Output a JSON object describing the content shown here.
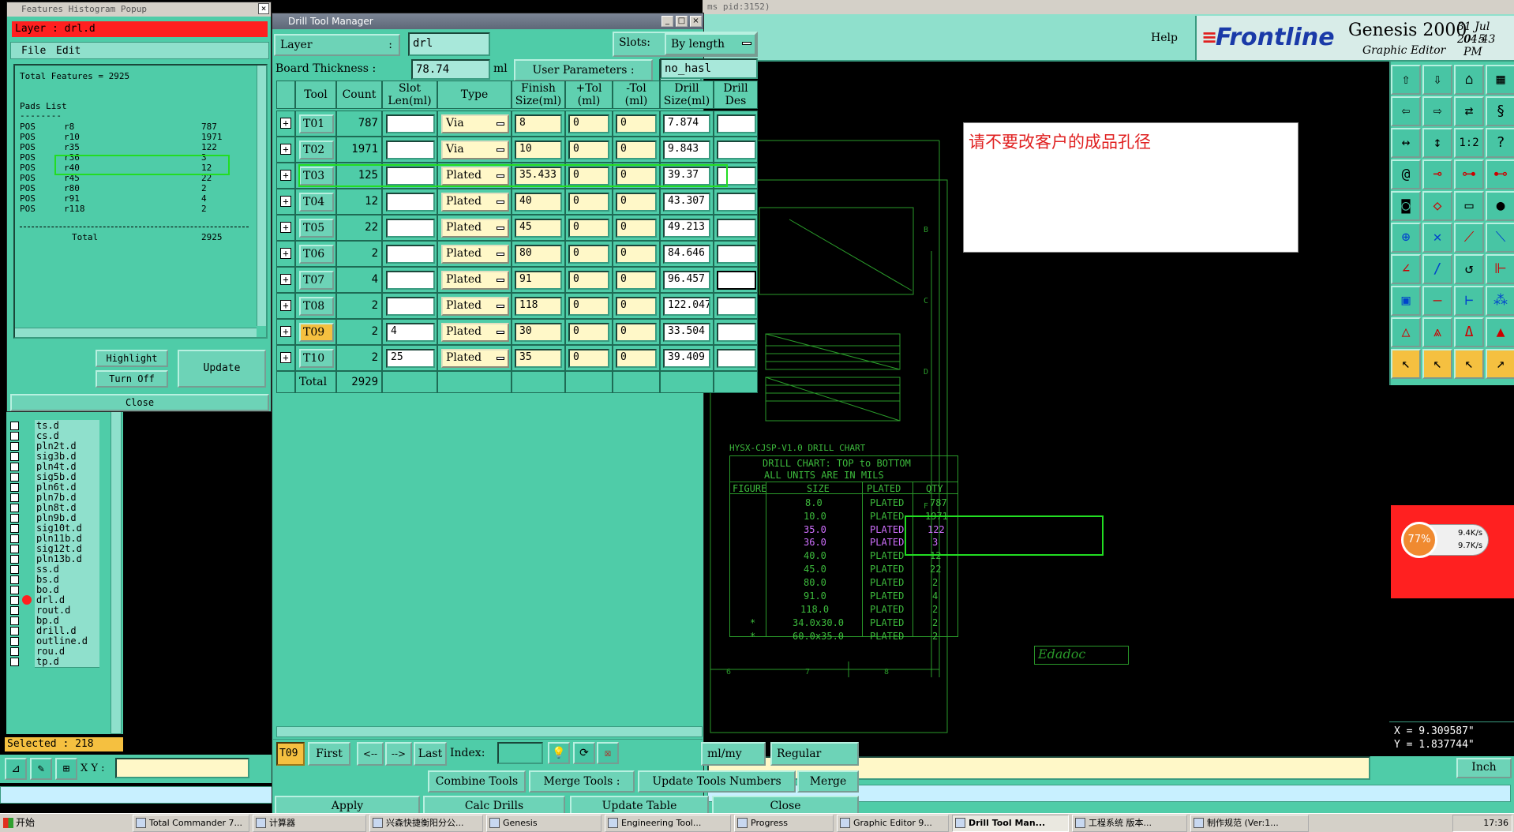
{
  "histogram": {
    "title": "Features Histogram Popup",
    "layer_label": "Layer : drl.d",
    "menu": [
      "File",
      "Edit"
    ],
    "total_features": "Total Features = 2925",
    "pads_list": "Pads List",
    "rows": [
      {
        "type": "POS",
        "sym": "r8",
        "count": "787"
      },
      {
        "type": "POS",
        "sym": "r10",
        "count": "1971"
      },
      {
        "type": "POS",
        "sym": "r35",
        "count": "122"
      },
      {
        "type": "POS",
        "sym": "r36",
        "count": "3"
      },
      {
        "type": "POS",
        "sym": "r40",
        "count": "12"
      },
      {
        "type": "POS",
        "sym": "r45",
        "count": "22"
      },
      {
        "type": "POS",
        "sym": "r80",
        "count": "2"
      },
      {
        "type": "POS",
        "sym": "r91",
        "count": "4"
      },
      {
        "type": "POS",
        "sym": "r118",
        "count": "2"
      }
    ],
    "total_label": "Total",
    "total_value": "2925",
    "highlight": "Highlight",
    "turn_off": "Turn Off",
    "update": "Update",
    "close": "Close"
  },
  "layers": {
    "items": [
      "ts.d",
      "cs.d",
      "pln2t.d",
      "sig3b.d",
      "pln4t.d",
      "sig5b.d",
      "pln6t.d",
      "pln7b.d",
      "pln8t.d",
      "pln9b.d",
      "sig10t.d",
      "pln11b.d",
      "sig12t.d",
      "pln13b.d",
      "ss.d",
      "bs.d",
      "bo.d",
      "drl.d",
      "rout.d",
      "bp.d",
      "drill.d",
      "outline.d",
      "rou.d",
      "tp.d"
    ],
    "selected": "Selected : 218",
    "xy_label": "X Y :"
  },
  "dtm": {
    "title": "Drill Tool Manager",
    "layer_label": "Layer",
    "layer_value": "drl",
    "slots_label": "Slots:",
    "slots_value": "By length",
    "board_thickness_label": "Board Thickness :",
    "board_thickness_value": "78.74",
    "board_thickness_unit": "ml",
    "user_params_label": "User Parameters :",
    "user_params_value": "no_hasl",
    "columns": [
      "Tool",
      "Count",
      "Slot Len(ml)",
      "Type",
      "Finish Size(ml)",
      "+Tol (ml)",
      "-Tol (ml)",
      "Drill Size(ml)",
      "Drill Des"
    ],
    "tools": [
      {
        "tool": "T01",
        "count": "787",
        "slot": "",
        "type": "Via",
        "finish": "8",
        "ptol": "0",
        "mtol": "0",
        "drill": "7.874"
      },
      {
        "tool": "T02",
        "count": "1971",
        "slot": "",
        "type": "Via",
        "finish": "10",
        "ptol": "0",
        "mtol": "0",
        "drill": "9.843"
      },
      {
        "tool": "T03",
        "count": "125",
        "slot": "",
        "type": "Plated",
        "finish": "35.433",
        "ptol": "0",
        "mtol": "0",
        "drill": "39.37"
      },
      {
        "tool": "T04",
        "count": "12",
        "slot": "",
        "type": "Plated",
        "finish": "40",
        "ptol": "0",
        "mtol": "0",
        "drill": "43.307"
      },
      {
        "tool": "T05",
        "count": "22",
        "slot": "",
        "type": "Plated",
        "finish": "45",
        "ptol": "0",
        "mtol": "0",
        "drill": "49.213"
      },
      {
        "tool": "T06",
        "count": "2",
        "slot": "",
        "type": "Plated",
        "finish": "80",
        "ptol": "0",
        "mtol": "0",
        "drill": "84.646"
      },
      {
        "tool": "T07",
        "count": "4",
        "slot": "",
        "type": "Plated",
        "finish": "91",
        "ptol": "0",
        "mtol": "0",
        "drill": "96.457"
      },
      {
        "tool": "T08",
        "count": "2",
        "slot": "",
        "type": "Plated",
        "finish": "118",
        "ptol": "0",
        "mtol": "0",
        "drill": "122.047"
      },
      {
        "tool": "T09",
        "count": "2",
        "slot": "4",
        "type": "Plated",
        "finish": "30",
        "ptol": "0",
        "mtol": "0",
        "drill": "33.504"
      },
      {
        "tool": "T10",
        "count": "2",
        "slot": "25",
        "type": "Plated",
        "finish": "35",
        "ptol": "0",
        "mtol": "0",
        "drill": "39.409"
      }
    ],
    "total_label": "Total",
    "total_value": "2929",
    "current_tool": "T09",
    "nav": [
      "First",
      "<--",
      "-->",
      "Last"
    ],
    "index_label": "Index:",
    "units": "ml/my",
    "mode": "Regular",
    "combine": "Combine Tools",
    "merge_tools": "Merge Tools :",
    "update_numbers": "Update Tools Numbers",
    "merge": "Merge",
    "apply": "Apply",
    "calc": "Calc Drills",
    "update_table": "Update Table",
    "close": "Close"
  },
  "genesis": {
    "help": "Help",
    "brand": "Frontline",
    "product": "Genesis 2000",
    "sub": "Graphic Editor",
    "date": "31 Jul 2015",
    "time": "04:43 PM",
    "note": "请不要改客户的成品孔径",
    "x": "X = 9.309587\"",
    "y": "Y = 1.837744\"",
    "unit": "Inch",
    "pid": "ms pid:3152)"
  },
  "drill_chart": {
    "heading": "HYSX-CJSP-V1.0 DRILL CHART",
    "title": "DRILL CHART: TOP to BOTTOM",
    "subtitle": "ALL UNITS ARE IN MILS",
    "cols": [
      "FIGURE",
      "SIZE",
      "PLATED",
      "QTY"
    ],
    "rows": [
      [
        "",
        "8.0",
        "PLATED",
        "787"
      ],
      [
        "",
        "10.0",
        "PLATED",
        "1971"
      ],
      [
        "",
        "35.0",
        "PLATED",
        "122"
      ],
      [
        "",
        "36.0",
        "PLATED",
        "3"
      ],
      [
        "",
        "40.0",
        "PLATED",
        "12"
      ],
      [
        "",
        "45.0",
        "PLATED",
        "22"
      ],
      [
        "",
        "80.0",
        "PLATED",
        "2"
      ],
      [
        "",
        "91.0",
        "PLATED",
        "4"
      ],
      [
        "",
        "118.0",
        "PLATED",
        "2"
      ],
      [
        "*",
        "34.0x30.0",
        "PLATED",
        "2"
      ],
      [
        "*",
        "60.0x35.0",
        "PLATED",
        "2"
      ]
    ]
  },
  "net_widget": {
    "percent": "77%",
    "up": "9.4K/s",
    "down": "9.7K/s"
  },
  "taskbar": {
    "start": "开始",
    "items": [
      "Total Commander 7...",
      "计算器",
      "兴森快捷衡阳分公...",
      "Genesis",
      "Engineering Tool...",
      "Progress",
      "Graphic Editor 9...",
      "Drill Tool Man...",
      "工程系统 版本...",
      "制作规范 (Ver:1..."
    ],
    "clock": "17:36"
  },
  "colors": {
    "teal": "#4fcca8",
    "yellow_field": "#fff8c8",
    "highlight_box": "#22dd22",
    "layer_red": "#ff2020"
  }
}
